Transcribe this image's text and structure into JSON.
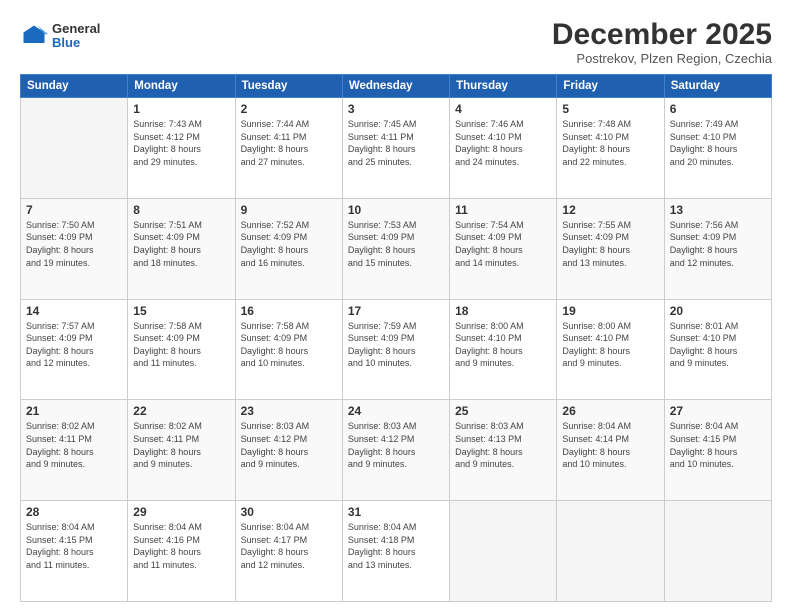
{
  "header": {
    "logo": {
      "general": "General",
      "blue": "Blue"
    },
    "title": "December 2025",
    "subtitle": "Postrekov, Plzen Region, Czechia"
  },
  "calendar": {
    "days_of_week": [
      "Sunday",
      "Monday",
      "Tuesday",
      "Wednesday",
      "Thursday",
      "Friday",
      "Saturday"
    ],
    "weeks": [
      [
        {
          "day": "",
          "info": ""
        },
        {
          "day": "1",
          "info": "Sunrise: 7:43 AM\nSunset: 4:12 PM\nDaylight: 8 hours\nand 29 minutes."
        },
        {
          "day": "2",
          "info": "Sunrise: 7:44 AM\nSunset: 4:11 PM\nDaylight: 8 hours\nand 27 minutes."
        },
        {
          "day": "3",
          "info": "Sunrise: 7:45 AM\nSunset: 4:11 PM\nDaylight: 8 hours\nand 25 minutes."
        },
        {
          "day": "4",
          "info": "Sunrise: 7:46 AM\nSunset: 4:10 PM\nDaylight: 8 hours\nand 24 minutes."
        },
        {
          "day": "5",
          "info": "Sunrise: 7:48 AM\nSunset: 4:10 PM\nDaylight: 8 hours\nand 22 minutes."
        },
        {
          "day": "6",
          "info": "Sunrise: 7:49 AM\nSunset: 4:10 PM\nDaylight: 8 hours\nand 20 minutes."
        }
      ],
      [
        {
          "day": "7",
          "info": "Sunrise: 7:50 AM\nSunset: 4:09 PM\nDaylight: 8 hours\nand 19 minutes."
        },
        {
          "day": "8",
          "info": "Sunrise: 7:51 AM\nSunset: 4:09 PM\nDaylight: 8 hours\nand 18 minutes."
        },
        {
          "day": "9",
          "info": "Sunrise: 7:52 AM\nSunset: 4:09 PM\nDaylight: 8 hours\nand 16 minutes."
        },
        {
          "day": "10",
          "info": "Sunrise: 7:53 AM\nSunset: 4:09 PM\nDaylight: 8 hours\nand 15 minutes."
        },
        {
          "day": "11",
          "info": "Sunrise: 7:54 AM\nSunset: 4:09 PM\nDaylight: 8 hours\nand 14 minutes."
        },
        {
          "day": "12",
          "info": "Sunrise: 7:55 AM\nSunset: 4:09 PM\nDaylight: 8 hours\nand 13 minutes."
        },
        {
          "day": "13",
          "info": "Sunrise: 7:56 AM\nSunset: 4:09 PM\nDaylight: 8 hours\nand 12 minutes."
        }
      ],
      [
        {
          "day": "14",
          "info": "Sunrise: 7:57 AM\nSunset: 4:09 PM\nDaylight: 8 hours\nand 12 minutes."
        },
        {
          "day": "15",
          "info": "Sunrise: 7:58 AM\nSunset: 4:09 PM\nDaylight: 8 hours\nand 11 minutes."
        },
        {
          "day": "16",
          "info": "Sunrise: 7:58 AM\nSunset: 4:09 PM\nDaylight: 8 hours\nand 10 minutes."
        },
        {
          "day": "17",
          "info": "Sunrise: 7:59 AM\nSunset: 4:09 PM\nDaylight: 8 hours\nand 10 minutes."
        },
        {
          "day": "18",
          "info": "Sunrise: 8:00 AM\nSunset: 4:10 PM\nDaylight: 8 hours\nand 9 minutes."
        },
        {
          "day": "19",
          "info": "Sunrise: 8:00 AM\nSunset: 4:10 PM\nDaylight: 8 hours\nand 9 minutes."
        },
        {
          "day": "20",
          "info": "Sunrise: 8:01 AM\nSunset: 4:10 PM\nDaylight: 8 hours\nand 9 minutes."
        }
      ],
      [
        {
          "day": "21",
          "info": "Sunrise: 8:02 AM\nSunset: 4:11 PM\nDaylight: 8 hours\nand 9 minutes."
        },
        {
          "day": "22",
          "info": "Sunrise: 8:02 AM\nSunset: 4:11 PM\nDaylight: 8 hours\nand 9 minutes."
        },
        {
          "day": "23",
          "info": "Sunrise: 8:03 AM\nSunset: 4:12 PM\nDaylight: 8 hours\nand 9 minutes."
        },
        {
          "day": "24",
          "info": "Sunrise: 8:03 AM\nSunset: 4:12 PM\nDaylight: 8 hours\nand 9 minutes."
        },
        {
          "day": "25",
          "info": "Sunrise: 8:03 AM\nSunset: 4:13 PM\nDaylight: 8 hours\nand 9 minutes."
        },
        {
          "day": "26",
          "info": "Sunrise: 8:04 AM\nSunset: 4:14 PM\nDaylight: 8 hours\nand 10 minutes."
        },
        {
          "day": "27",
          "info": "Sunrise: 8:04 AM\nSunset: 4:15 PM\nDaylight: 8 hours\nand 10 minutes."
        }
      ],
      [
        {
          "day": "28",
          "info": "Sunrise: 8:04 AM\nSunset: 4:15 PM\nDaylight: 8 hours\nand 11 minutes."
        },
        {
          "day": "29",
          "info": "Sunrise: 8:04 AM\nSunset: 4:16 PM\nDaylight: 8 hours\nand 11 minutes."
        },
        {
          "day": "30",
          "info": "Sunrise: 8:04 AM\nSunset: 4:17 PM\nDaylight: 8 hours\nand 12 minutes."
        },
        {
          "day": "31",
          "info": "Sunrise: 8:04 AM\nSunset: 4:18 PM\nDaylight: 8 hours\nand 13 minutes."
        },
        {
          "day": "",
          "info": ""
        },
        {
          "day": "",
          "info": ""
        },
        {
          "day": "",
          "info": ""
        }
      ]
    ]
  }
}
